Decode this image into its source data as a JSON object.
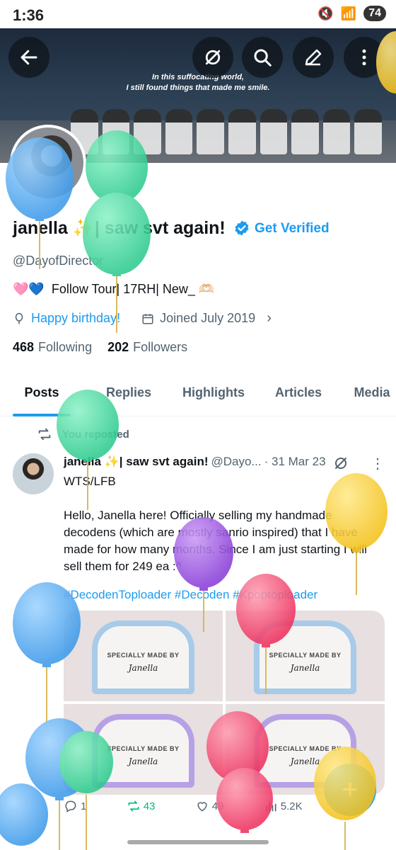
{
  "status_bar": {
    "time": "1:36",
    "battery": "74"
  },
  "banner": {
    "caption_line1": "In this suffocating world,",
    "caption_line2": "I still found things that made me smile."
  },
  "profile": {
    "name": "janella ✨| saw svt again!",
    "get_verified": "Get Verified",
    "handle": "@DayofDirector",
    "bio_hearts": "🩷💙",
    "bio": "Follow Tour| 17RH| New_ 🫶🏻",
    "birthday": "Happy birthday!",
    "joined": "Joined July 2019",
    "following_count": "468",
    "following_label": "Following",
    "followers_count": "202",
    "followers_label": "Followers"
  },
  "tabs": [
    "Posts",
    "Replies",
    "Highlights",
    "Articles",
    "Media"
  ],
  "tweet": {
    "repost_label": "You reposted",
    "name": "janella ✨| saw svt again!",
    "handle": "@Dayo...",
    "date": "· 31 Mar 23",
    "text": "WTS/LFB\n\nHello, Janella here! Officially selling my handmade decodens (which are mostly sanrio inspired) that I have made for how many months. Since I am just starting I will sell them for 249 ea :^",
    "hashtags": "#DecodenToploader #Decoden #Kpoptoploader",
    "media_label": "SPECIALLY MADE BY",
    "media_name": "Janella",
    "replies": "1",
    "reposts": "43",
    "likes": "49",
    "views": "5.2K"
  },
  "icons": {
    "back": "arrow-left-icon",
    "grok": "grok-icon",
    "search": "search-icon",
    "edit": "edit-icon",
    "more": "more-vertical-icon"
  },
  "colors": {
    "accent": "#1d9bf0",
    "repost_green": "#00ba7c",
    "balloon_blue": "#4aa9f0",
    "balloon_green": "#3fd49c",
    "balloon_purple": "#9b4fe0",
    "balloon_red": "#f0436a",
    "balloon_yellow": "#f7cf2b"
  }
}
